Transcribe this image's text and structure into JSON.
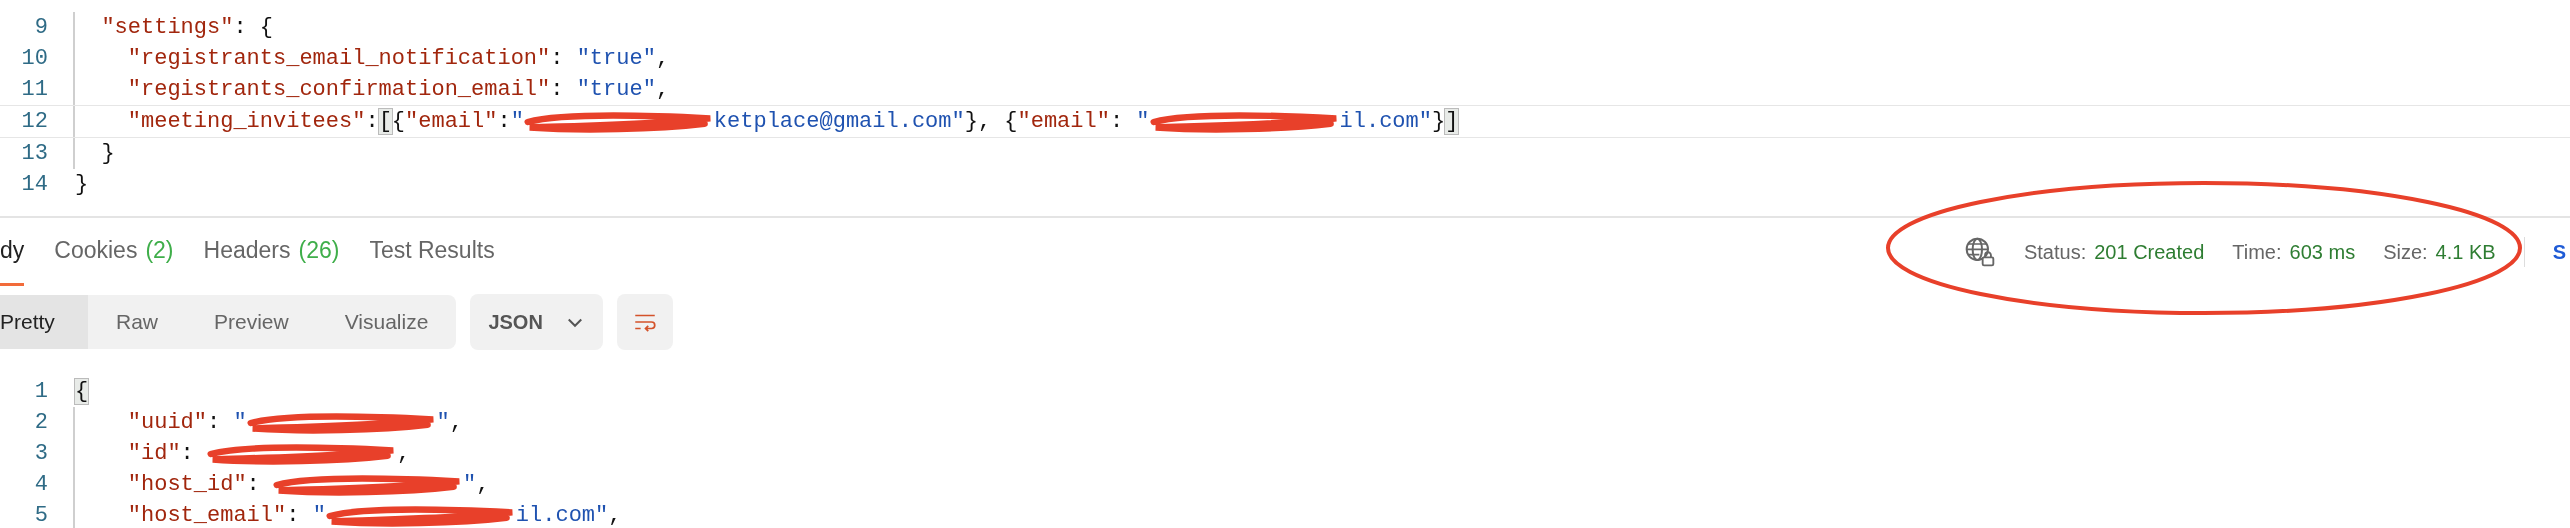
{
  "request_body": {
    "lines": [
      {
        "number": "9",
        "tokens": [
          {
            "kind": "indent"
          },
          {
            "kind": "key",
            "text": "\"settings\""
          },
          {
            "kind": "punct",
            "text": ": {"
          }
        ]
      },
      {
        "number": "10",
        "tokens": [
          {
            "kind": "indent"
          },
          {
            "kind": "indent"
          },
          {
            "kind": "key",
            "text": "\"registrants_email_notification\""
          },
          {
            "kind": "punct",
            "text": ": "
          },
          {
            "kind": "str",
            "text": "\"true\""
          },
          {
            "kind": "punct",
            "text": ","
          }
        ]
      },
      {
        "number": "11",
        "tokens": [
          {
            "kind": "indent"
          },
          {
            "kind": "indent"
          },
          {
            "kind": "key",
            "text": "\"registrants_confirmation_email\""
          },
          {
            "kind": "punct",
            "text": ": "
          },
          {
            "kind": "str",
            "text": "\"true\""
          },
          {
            "kind": "punct",
            "text": ","
          }
        ]
      },
      {
        "number": "12",
        "tokens": [
          {
            "kind": "indent"
          },
          {
            "kind": "indent"
          },
          {
            "kind": "key",
            "text": "\"meeting_invitees\""
          },
          {
            "kind": "punct",
            "text": ":"
          },
          {
            "kind": "bracket",
            "text": "["
          },
          {
            "kind": "punct",
            "text": "{"
          },
          {
            "kind": "key",
            "text": "\"email\""
          },
          {
            "kind": "punct",
            "text": ":"
          },
          {
            "kind": "str",
            "text": "\""
          },
          {
            "kind": "redacted"
          },
          {
            "kind": "str",
            "text": "ketplace@gmail.com\""
          },
          {
            "kind": "punct",
            "text": "}, {"
          },
          {
            "kind": "key",
            "text": "\"email\""
          },
          {
            "kind": "punct",
            "text": ": "
          },
          {
            "kind": "str",
            "text": "\""
          },
          {
            "kind": "redacted"
          },
          {
            "kind": "str",
            "text": "il.com\""
          },
          {
            "kind": "punct",
            "text": "}"
          },
          {
            "kind": "bracket",
            "text": "]"
          }
        ]
      },
      {
        "number": "13",
        "tokens": [
          {
            "kind": "indent"
          },
          {
            "kind": "punct",
            "text": "}"
          }
        ]
      },
      {
        "number": "14",
        "tokens": [
          {
            "kind": "punct",
            "text": "}"
          }
        ]
      }
    ]
  },
  "response": {
    "tabs": [
      {
        "label": "dy",
        "selected": true
      },
      {
        "label": "Cookies",
        "count": "(2)",
        "selected": false
      },
      {
        "label": "Headers",
        "count": "(26)",
        "selected": false
      },
      {
        "label": "Test Results",
        "selected": false
      }
    ],
    "view_modes": [
      {
        "label": "Pretty",
        "selected": true
      },
      {
        "label": "Raw",
        "selected": false
      },
      {
        "label": "Preview",
        "selected": false
      },
      {
        "label": "Visualize",
        "selected": false
      }
    ],
    "format": "JSON",
    "status": [
      {
        "label": "Status:",
        "value": "201 Created"
      },
      {
        "label": "Time:",
        "value": "603 ms"
      },
      {
        "label": "Size:",
        "value": "4.1 KB"
      }
    ],
    "save_label": "S"
  },
  "response_body": {
    "lines": [
      {
        "number": "1",
        "tokens": [
          {
            "kind": "bracket",
            "text": "{"
          }
        ]
      },
      {
        "number": "2",
        "tokens": [
          {
            "kind": "indent"
          },
          {
            "kind": "indent"
          },
          {
            "kind": "key",
            "text": "\"uuid\""
          },
          {
            "kind": "punct",
            "text": ": "
          },
          {
            "kind": "str",
            "text": "\""
          },
          {
            "kind": "redacted"
          },
          {
            "kind": "str",
            "text": "\""
          },
          {
            "kind": "punct",
            "text": ","
          }
        ]
      },
      {
        "number": "3",
        "tokens": [
          {
            "kind": "indent"
          },
          {
            "kind": "indent"
          },
          {
            "kind": "key",
            "text": "\"id\""
          },
          {
            "kind": "punct",
            "text": ": "
          },
          {
            "kind": "redacted"
          },
          {
            "kind": "punct",
            "text": ","
          }
        ]
      },
      {
        "number": "4",
        "tokens": [
          {
            "kind": "indent"
          },
          {
            "kind": "indent"
          },
          {
            "kind": "key",
            "text": "\"host_id\""
          },
          {
            "kind": "punct",
            "text": ": "
          },
          {
            "kind": "redacted"
          },
          {
            "kind": "str",
            "text": "\""
          },
          {
            "kind": "punct",
            "text": ","
          }
        ]
      },
      {
        "number": "5",
        "tokens": [
          {
            "kind": "indent"
          },
          {
            "kind": "indent"
          },
          {
            "kind": "key",
            "text": "\"host_email\""
          },
          {
            "kind": "punct",
            "text": ": "
          },
          {
            "kind": "str",
            "text": "\""
          },
          {
            "kind": "redacted"
          },
          {
            "kind": "str",
            "text": "il.com\""
          },
          {
            "kind": "punct",
            "text": ","
          }
        ]
      }
    ]
  }
}
